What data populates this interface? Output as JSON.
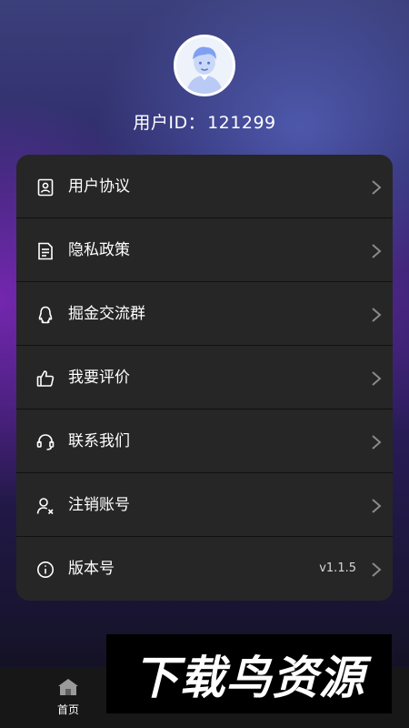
{
  "profile": {
    "avatar_icon": "user-avatar-icon",
    "id_label": "用户ID：",
    "id_value": "121299"
  },
  "menu": [
    {
      "icon": "user-document-icon",
      "label": "用户协议",
      "value": ""
    },
    {
      "icon": "document-list-icon",
      "label": "隐私政策",
      "value": ""
    },
    {
      "icon": "qq-penguin-icon",
      "label": "掘金交流群",
      "value": ""
    },
    {
      "icon": "thumbs-up-icon",
      "label": "我要评价",
      "value": ""
    },
    {
      "icon": "headset-icon",
      "label": "联系我们",
      "value": ""
    },
    {
      "icon": "user-remove-icon",
      "label": "注销账号",
      "value": ""
    },
    {
      "icon": "info-icon",
      "label": "版本号",
      "value": "v1.1.5"
    }
  ],
  "bottom_nav": {
    "home_label": "首页",
    "home_icon": "home-icon"
  },
  "watermark": {
    "text": "下载鸟资源"
  },
  "colors": {
    "card_bg": "#262626",
    "bottom_bar_bg": "#171717",
    "text": "#ffffff",
    "chevron": "#8a8a8a"
  }
}
